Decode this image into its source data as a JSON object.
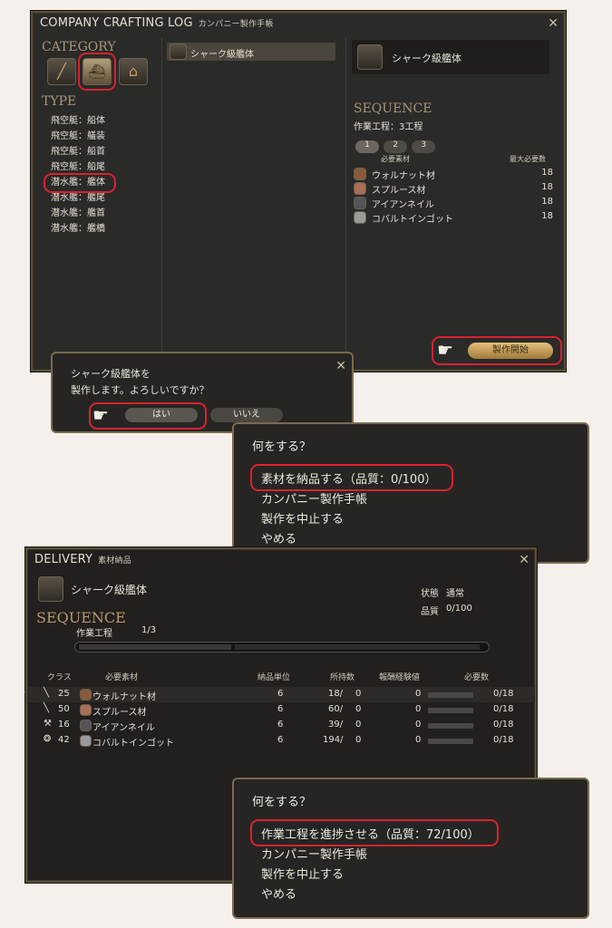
{
  "crafting_log": {
    "title": "COMPANY CRAFTING LOG",
    "subtitle": "カンパニー製作手帳",
    "category_label": "CATEGORY",
    "type_label": "TYPE",
    "types": [
      "飛空艇：船体",
      "飛空艇：艤装",
      "飛空艇：船首",
      "飛空艇：船尾",
      "潜水艦：艦体",
      "潜水艦：艦尾",
      "潜水艦：艦首",
      "潜水艦：艦橋"
    ],
    "recipe_list_item": "シャーク級艦体",
    "detail_title": "シャーク級艦体",
    "sequence_label": "SEQUENCE",
    "process_text": "作業工程：3工程",
    "steps": [
      "1",
      "2",
      "3"
    ],
    "col_material": "必要素材",
    "col_max": "最大必要数",
    "materials": [
      {
        "name": "ウォルナット材",
        "qty": "18"
      },
      {
        "name": "スプルース材",
        "qty": "18"
      },
      {
        "name": "アイアンネイル",
        "qty": "18"
      },
      {
        "name": "コバルトインゴット",
        "qty": "18"
      }
    ],
    "start_button": "製作開始"
  },
  "confirm": {
    "line1": "シャーク級艦体を",
    "line2": "製作します。よろしいですか？",
    "yes": "はい",
    "no": "いいえ"
  },
  "menu1": {
    "question": "何をする？",
    "options": [
      "素材を納品する（品質：0/100）",
      "カンパニー製作手帳",
      "製作を中止する",
      "やめる"
    ]
  },
  "delivery": {
    "title": "DELIVERY",
    "subtitle": "素材納品",
    "item": "シャーク級艦体",
    "status_label": "状態",
    "status_value": "通常",
    "quality_label": "品質",
    "quality_value": "0/100",
    "sequence_label": "SEQUENCE",
    "process_label": "作業工程",
    "process_value": "1/3",
    "headers": [
      "クラス",
      "必要素材",
      "納品単位",
      "所持数",
      "報酬経験値",
      "必要数"
    ],
    "rows": [
      {
        "class": "25",
        "name": "ウォルナット材",
        "unit": "6",
        "owned": "18/",
        "owned_hq": "0",
        "exp": "0",
        "need": "0/18"
      },
      {
        "class": "50",
        "name": "スプルース材",
        "unit": "6",
        "owned": "60/",
        "owned_hq": "0",
        "exp": "0",
        "need": "0/18"
      },
      {
        "class": "16",
        "name": "アイアンネイル",
        "unit": "6",
        "owned": "39/",
        "owned_hq": "0",
        "exp": "0",
        "need": "0/18"
      },
      {
        "class": "42",
        "name": "コバルトインゴット",
        "unit": "6",
        "owned": "194/",
        "owned_hq": "0",
        "exp": "0",
        "need": "0/18"
      }
    ]
  },
  "menu2": {
    "question": "何をする？",
    "options": [
      "作業工程を進捗させる（品質：72/100）",
      "カンパニー製作手帳",
      "製作を中止する",
      "やめる"
    ]
  }
}
